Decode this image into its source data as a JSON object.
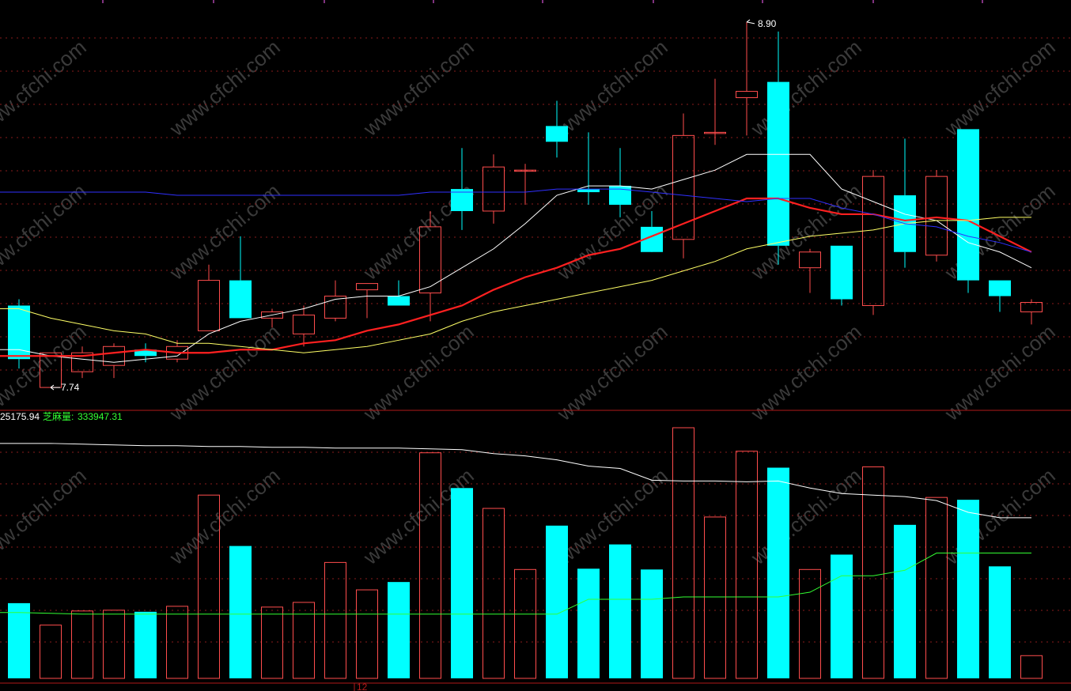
{
  "colors": {
    "background": "#000000",
    "up": "#ff4d4d",
    "down": "#00ffff",
    "grid": "#8a1c1c",
    "panel_border": "#b01a1a",
    "ma_white": "#ffffff",
    "ma_red": "#ff2020",
    "ma_yellow": "#ffff66",
    "ma_blue": "#3030ff",
    "vol_ma_white": "#ffffff",
    "vol_ma_green": "#33ff33",
    "label_white": "#ffffff",
    "label_green": "#33ff33"
  },
  "watermark": "www.cfchi.com",
  "price_panel": {
    "high_label": "8.90",
    "low_label": "7.74"
  },
  "volume_panel": {
    "value_label": "25175.94",
    "name_label": "芝麻量:",
    "name_value": "333947.31"
  },
  "xaxis": {
    "tick_label": "12"
  },
  "chart_data": {
    "type": "candlestick",
    "price_range": [
      7.7,
      8.95
    ],
    "volume_range": [
      0,
      320000
    ],
    "candles": [
      {
        "o": 8.0,
        "h": 8.02,
        "l": 7.8,
        "c": 7.83,
        "v": 96000
      },
      {
        "o": 7.74,
        "h": 7.85,
        "l": 7.74,
        "c": 7.85,
        "v": 68000
      },
      {
        "o": 7.79,
        "h": 7.87,
        "l": 7.77,
        "c": 7.85,
        "v": 86000
      },
      {
        "o": 7.81,
        "h": 7.88,
        "l": 7.77,
        "c": 7.87,
        "v": 87000
      },
      {
        "o": 7.86,
        "h": 7.88,
        "l": 7.82,
        "c": 7.84,
        "v": 85000
      },
      {
        "o": 7.83,
        "h": 7.89,
        "l": 7.82,
        "c": 7.87,
        "v": 92000
      },
      {
        "o": 7.92,
        "h": 8.13,
        "l": 7.92,
        "c": 8.08,
        "v": 234000
      },
      {
        "o": 8.08,
        "h": 8.22,
        "l": 7.98,
        "c": 7.96,
        "v": 169000
      },
      {
        "o": 7.96,
        "h": 7.99,
        "l": 7.93,
        "c": 7.98,
        "v": 91000
      },
      {
        "o": 7.91,
        "h": 8.0,
        "l": 7.87,
        "c": 7.97,
        "v": 97000
      },
      {
        "o": 7.96,
        "h": 8.08,
        "l": 7.95,
        "c": 8.03,
        "v": 148000
      },
      {
        "o": 8.05,
        "h": 8.07,
        "l": 7.96,
        "c": 8.07,
        "v": 113000
      },
      {
        "o": 8.03,
        "h": 8.08,
        "l": 8.01,
        "c": 8.0,
        "v": 123000
      },
      {
        "o": 8.04,
        "h": 8.3,
        "l": 7.95,
        "c": 8.25,
        "v": 288000
      },
      {
        "o": 8.37,
        "h": 8.5,
        "l": 8.24,
        "c": 8.3,
        "v": 243000
      },
      {
        "o": 8.3,
        "h": 8.48,
        "l": 8.26,
        "c": 8.44,
        "v": 217000
      },
      {
        "o": 8.43,
        "h": 8.45,
        "l": 8.32,
        "c": 8.43,
        "v": 139000
      },
      {
        "o": 8.57,
        "h": 8.65,
        "l": 8.47,
        "c": 8.52,
        "v": 195000
      },
      {
        "o": 8.37,
        "h": 8.55,
        "l": 8.32,
        "c": 8.36,
        "v": 140000
      },
      {
        "o": 8.38,
        "h": 8.5,
        "l": 8.28,
        "c": 8.32,
        "v": 171000
      },
      {
        "o": 8.25,
        "h": 8.3,
        "l": 8.19,
        "c": 8.17,
        "v": 139000
      },
      {
        "o": 8.21,
        "h": 8.61,
        "l": 8.15,
        "c": 8.54,
        "v": 320000
      },
      {
        "o": 8.55,
        "h": 8.72,
        "l": 8.51,
        "c": 8.55,
        "v": 206000
      },
      {
        "o": 8.66,
        "h": 8.9,
        "l": 8.54,
        "c": 8.68,
        "v": 290000
      },
      {
        "o": 8.71,
        "h": 8.87,
        "l": 8.13,
        "c": 8.19,
        "v": 269000
      },
      {
        "o": 8.12,
        "h": 8.18,
        "l": 8.04,
        "c": 8.17,
        "v": 139000
      },
      {
        "o": 8.19,
        "h": 8.19,
        "l": 8.0,
        "c": 8.02,
        "v": 158000
      },
      {
        "o": 8.0,
        "h": 8.43,
        "l": 7.97,
        "c": 8.41,
        "v": 270000
      },
      {
        "o": 8.35,
        "h": 8.53,
        "l": 8.12,
        "c": 8.17,
        "v": 196000
      },
      {
        "o": 8.16,
        "h": 8.43,
        "l": 8.14,
        "c": 8.41,
        "v": 231000
      },
      {
        "o": 8.56,
        "h": 8.56,
        "l": 8.04,
        "c": 8.08,
        "v": 228000
      },
      {
        "o": 8.08,
        "h": 8.08,
        "l": 7.98,
        "c": 8.03,
        "v": 143000
      },
      {
        "o": 7.98,
        "h": 8.02,
        "l": 7.94,
        "c": 8.01,
        "v": 29000
      }
    ],
    "ma_price": [
      {
        "name": "white",
        "values": [
          7.86,
          7.84,
          7.83,
          7.82,
          7.83,
          7.84,
          7.91,
          7.95,
          7.97,
          7.99,
          8.02,
          8.03,
          8.03,
          8.06,
          8.12,
          8.18,
          8.26,
          8.35,
          8.38,
          8.38,
          8.37,
          8.4,
          8.43,
          8.48,
          8.48,
          8.48,
          8.37,
          8.33,
          8.29,
          8.27,
          8.2,
          8.17,
          8.12
        ]
      },
      {
        "name": "red",
        "values": [
          7.84,
          7.84,
          7.84,
          7.85,
          7.86,
          7.85,
          7.85,
          7.86,
          7.86,
          7.88,
          7.89,
          7.92,
          7.94,
          7.97,
          8.0,
          8.05,
          8.09,
          8.12,
          8.16,
          8.18,
          8.22,
          8.26,
          8.3,
          8.34,
          8.34,
          8.31,
          8.29,
          8.29,
          8.27,
          8.28,
          8.27,
          8.22,
          8.17
        ]
      },
      {
        "name": "yellow",
        "values": [
          7.99,
          7.96,
          7.94,
          7.92,
          7.91,
          7.88,
          7.88,
          7.87,
          7.86,
          7.85,
          7.86,
          7.87,
          7.89,
          7.91,
          7.95,
          7.98,
          8.0,
          8.02,
          8.04,
          8.06,
          8.08,
          8.11,
          8.14,
          8.18,
          8.2,
          8.22,
          8.23,
          8.24,
          8.26,
          8.27,
          8.27,
          8.28,
          8.28
        ]
      },
      {
        "name": "blue",
        "values": [
          8.36,
          8.36,
          8.36,
          8.36,
          8.36,
          8.35,
          8.35,
          8.35,
          8.35,
          8.35,
          8.35,
          8.35,
          8.35,
          8.36,
          8.36,
          8.36,
          8.36,
          8.37,
          8.37,
          8.37,
          8.36,
          8.35,
          8.34,
          8.33,
          8.34,
          8.34,
          8.31,
          8.29,
          8.26,
          8.25,
          8.22,
          8.2,
          8.17
        ]
      }
    ],
    "ma_volume": [
      {
        "name": "white",
        "values": [
          300000,
          300000,
          299000,
          298000,
          297000,
          297000,
          296000,
          296000,
          295000,
          295000,
          294000,
          294000,
          294000,
          293000,
          292000,
          287000,
          284000,
          279000,
          271000,
          268000,
          253000,
          252000,
          252000,
          251000,
          252000,
          243000,
          236000,
          234000,
          232000,
          227000,
          212000,
          205000,
          205000
        ]
      },
      {
        "name": "green",
        "values": [
          84000,
          83000,
          82000,
          82000,
          82000,
          82000,
          82000,
          82000,
          82000,
          82000,
          82000,
          82000,
          82000,
          82000,
          82000,
          82000,
          82000,
          82000,
          101000,
          101000,
          101000,
          104000,
          104000,
          104000,
          104000,
          110000,
          131000,
          131000,
          138000,
          160000,
          160000,
          160000,
          160000
        ]
      }
    ]
  }
}
